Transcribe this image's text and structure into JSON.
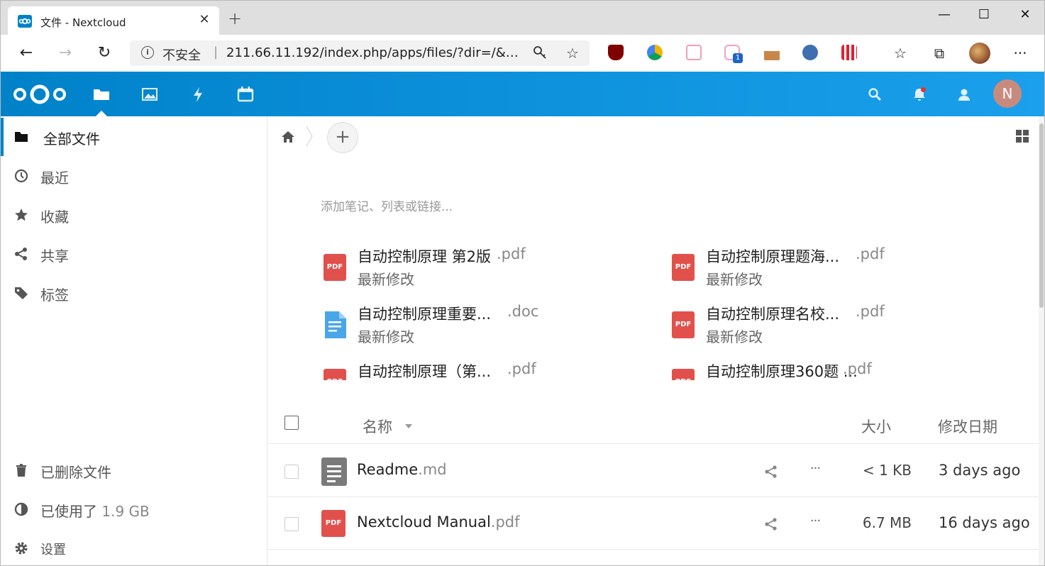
{
  "browser": {
    "tab_title": "文件 - Nextcloud",
    "tab_close": "✕",
    "new_tab": "+",
    "window_controls": {
      "minimize": "—",
      "maximize": "☐",
      "close": "✕"
    },
    "nav": {
      "back": "←",
      "forward": "→",
      "reload": "↻"
    },
    "address": {
      "info": "i",
      "insecure_label": "不安全",
      "separator": "|",
      "url": "211.66.11.192/index.php/apps/files/?dir=/&fi..."
    },
    "extension_badge": "1",
    "toolbar_icons": [
      "key-icon",
      "star-icon",
      "ublock-icon",
      "extension-icon",
      "tv-icon",
      "cat-icon",
      "tree-icon",
      "glasses-icon",
      "qrcode-icon",
      "favorites-icon",
      "collections-icon",
      "profile-avatar",
      "more-icon"
    ],
    "more_label": "···"
  },
  "header": {
    "apps": [
      "files",
      "photos",
      "activity",
      "calendar"
    ],
    "avatar_letter": "N",
    "brand_color": "#0082c9"
  },
  "sidebar": {
    "items": [
      {
        "label": "全部文件",
        "icon": "folder-icon",
        "active": true
      },
      {
        "label": "最近",
        "icon": "clock-icon"
      },
      {
        "label": "收藏",
        "icon": "star-icon"
      },
      {
        "label": "共享",
        "icon": "share-icon"
      },
      {
        "label": "标签",
        "icon": "tag-icon"
      }
    ],
    "trash": "已删除文件",
    "quota_label": "已使用了",
    "quota_value": "1.9 GB",
    "settings": "设置"
  },
  "content": {
    "add_button": "+",
    "note_placeholder": "添加笔记、列表或链接...",
    "recent": [
      {
        "name": "自动控制原理 第2版",
        "ext": ".pdf",
        "sub": "最新修改",
        "type": "pdf"
      },
      {
        "name": "自动控制原理题海...",
        "ext": ".pdf",
        "sub": "最新修改",
        "type": "pdf"
      },
      {
        "name": "自动控制原理重要...",
        "ext": ".doc",
        "sub": "最新修改",
        "type": "doc"
      },
      {
        "name": "自动控制原理名校...",
        "ext": ".pdf",
        "sub": "最新修改",
        "type": "pdf"
      },
      {
        "name": "自动控制原理（第...",
        "ext": ".pdf",
        "sub": "",
        "type": "pdf"
      },
      {
        "name": "自动控制原理360题 ...",
        "ext": ".pdf",
        "sub": "",
        "type": "pdf"
      }
    ],
    "pdf_label": "PDF",
    "columns": {
      "name": "名称",
      "size": "大小",
      "modified": "修改日期"
    },
    "files": [
      {
        "name": "Readme",
        "ext": ".md",
        "size": "< 1 KB",
        "modified": "3 days ago",
        "type": "md"
      },
      {
        "name": "Nextcloud Manual",
        "ext": ".pdf",
        "size": "6.7 MB",
        "modified": "16 days ago",
        "type": "pdf"
      }
    ],
    "more_label": "···"
  }
}
